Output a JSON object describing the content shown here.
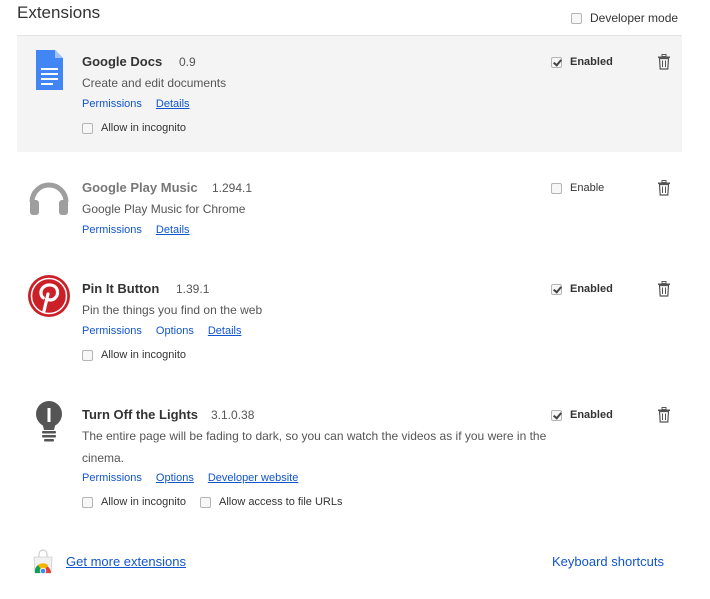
{
  "page": {
    "title": "Extensions",
    "developer_mode_label": "Developer mode",
    "developer_mode_checked": false
  },
  "extensions": [
    {
      "name": "Google Docs",
      "version": "0.9",
      "description": "Create and edit documents",
      "links": [
        "Permissions",
        "Details"
      ],
      "options": [
        {
          "label": "Allow in incognito",
          "checked": false
        }
      ],
      "enable_label": "Enabled",
      "enabled": true,
      "icon": "google-docs-icon",
      "color": "#4285f4"
    },
    {
      "name": "Google Play Music",
      "version": "1.294.1",
      "description": "Google Play Music for Chrome",
      "links": [
        "Permissions",
        "Details"
      ],
      "options": [],
      "enable_label": "Enable",
      "enabled": false,
      "icon": "headphones-icon",
      "color": "#9e9e9e"
    },
    {
      "name": "Pin It Button",
      "version": "1.39.1",
      "description": "Pin the things you find on the web",
      "links": [
        "Permissions",
        "Options",
        "Details"
      ],
      "options": [
        {
          "label": "Allow in incognito",
          "checked": false
        }
      ],
      "enable_label": "Enabled",
      "enabled": true,
      "icon": "pinterest-icon",
      "color": "#cb2027"
    },
    {
      "name": "Turn Off the Lights",
      "version": "3.1.0.38",
      "description": "The entire page will be fading to dark, so you can watch the videos as if you were in the cinema.",
      "links": [
        "Permissions",
        "Options",
        "Developer website"
      ],
      "options": [
        {
          "label": "Allow in incognito",
          "checked": false
        },
        {
          "label": "Allow access to file URLs",
          "checked": false
        }
      ],
      "enable_label": "Enabled",
      "enabled": true,
      "icon": "lightbulb-icon",
      "color": "#555555"
    }
  ],
  "footer": {
    "get_more_label": "Get more extensions",
    "keyboard_shortcuts_label": "Keyboard shortcuts"
  }
}
